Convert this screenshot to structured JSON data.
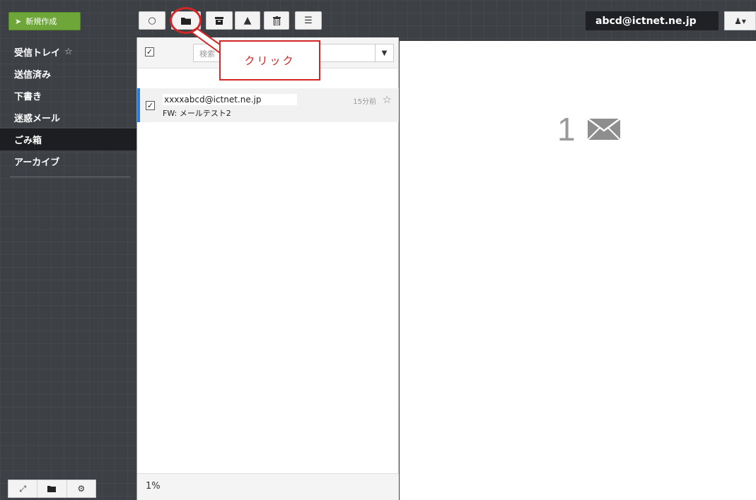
{
  "toolbar": {
    "compose_label": "新規作成",
    "account_email": "abcd@ictnet.ne.jp"
  },
  "sidebar": {
    "folders": [
      {
        "label": "受信トレイ",
        "starred": true
      },
      {
        "label": "送信済み"
      },
      {
        "label": "下書き"
      },
      {
        "label": "迷惑メール"
      },
      {
        "label": "ごみ箱",
        "active": true
      },
      {
        "label": "アーカイブ"
      }
    ]
  },
  "list": {
    "search_placeholder": "検索",
    "messages": [
      {
        "from": "xxxxabcd@ictnet.ne.jp",
        "subject": "FW: メールテスト2",
        "time": "15分前",
        "selected": true
      }
    ],
    "footer_percent": "1%"
  },
  "preview": {
    "selected_count": "1"
  },
  "annotation": {
    "callout_text": "クリック",
    "color": "#d32626"
  },
  "icons": [
    "compose-icon",
    "refresh-icon",
    "folder-icon",
    "archive-icon",
    "warning-icon",
    "trash-icon",
    "menu-icon",
    "user-icon",
    "collapse-icon",
    "folder-manage-icon",
    "settings-icon",
    "envelope-icon",
    "star-icon"
  ]
}
